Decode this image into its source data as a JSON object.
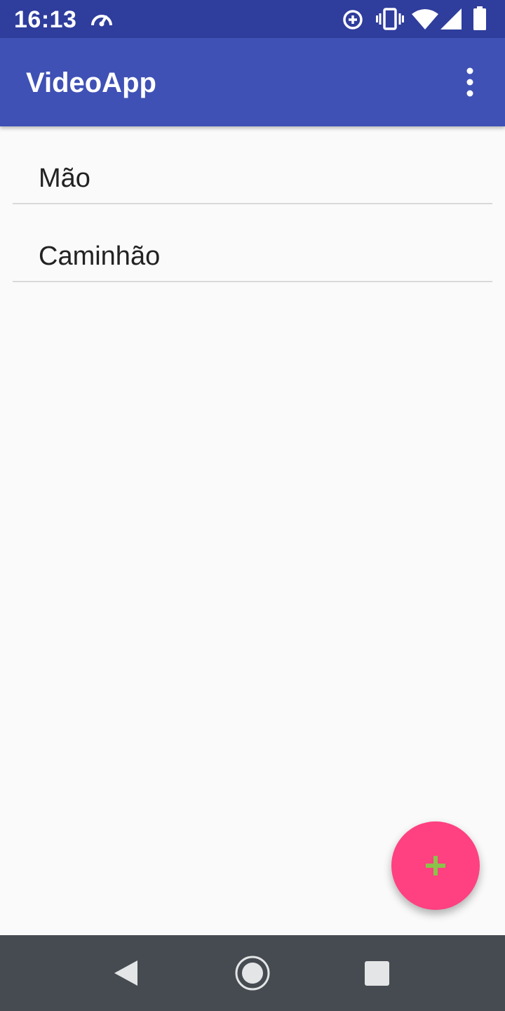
{
  "status_bar": {
    "time": "16:13",
    "icons": [
      "speedometer-icon",
      "data-saver-icon",
      "vibrate-icon",
      "wifi-icon",
      "signal-icon",
      "battery-icon"
    ]
  },
  "app_bar": {
    "title": "VideoApp",
    "menu_icon": "more-vert-icon"
  },
  "list": {
    "items": [
      {
        "label": "Mão"
      },
      {
        "label": "Caminhão"
      }
    ]
  },
  "fab": {
    "icon": "add-icon",
    "background_color": "#ff4081",
    "icon_color": "#8bc34a"
  },
  "nav_bar": {
    "buttons": [
      "back-icon",
      "home-icon",
      "recents-icon"
    ]
  },
  "colors": {
    "status_bar": "#2f3d9c",
    "primary": "#3f51b5",
    "accent": "#ff4081",
    "background": "#fafafa",
    "nav_bar": "#464b51"
  }
}
